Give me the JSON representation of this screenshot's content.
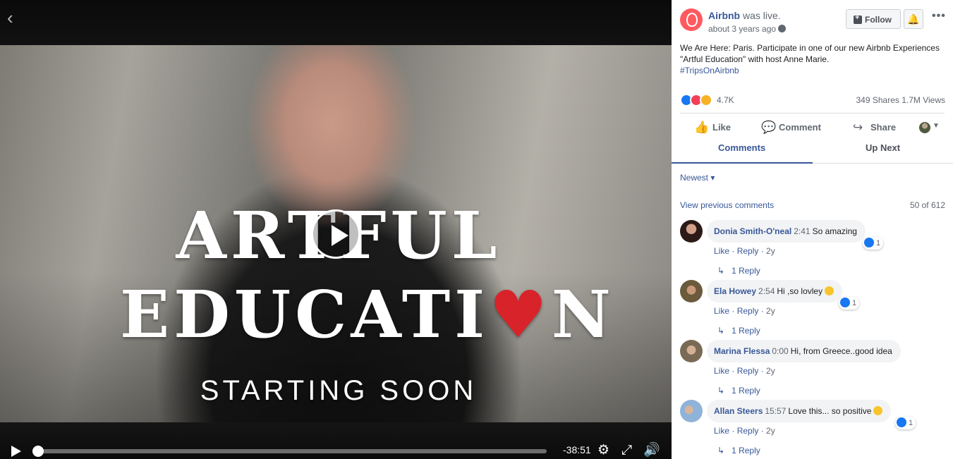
{
  "video": {
    "overlay_line1": "ARTFUL",
    "overlay_line2a": "EDUCATI",
    "overlay_heart": "♥",
    "overlay_line2b": "N",
    "overlay_line3": "STARTING SOON",
    "time_remaining": "-38:51",
    "progress_fraction": 0.01
  },
  "post": {
    "page_name": "Airbnb",
    "status": "was live.",
    "time": "about 3 years ago",
    "follow_label": "Follow",
    "text": "We Are Here: Paris. Participate in one of our new Airbnb Experiences \"Artful Education\" with host Anne Marie.",
    "hashtag": "#TripsOnAirbnb",
    "reaction_count": "4.7K",
    "shares_views": "349 Shares  1.7M Views",
    "brand_color": "#ff5a5f"
  },
  "actions": {
    "like": "Like",
    "comment": "Comment",
    "share": "Share"
  },
  "tabs": {
    "comments": "Comments",
    "up_next": "Up Next"
  },
  "comments_section": {
    "sort_label": "Newest ▾",
    "view_previous": "View previous comments",
    "count": "50 of 612",
    "items": [
      {
        "name": "Donia Smith-O'neal",
        "ts": "2:41",
        "text": "So amazing",
        "like": "Like",
        "reply": "Reply",
        "age": "2y",
        "likes": "1",
        "replies": "1 Reply"
      },
      {
        "name": "Ela Howey",
        "ts": "2:54",
        "text": "Hi ,so lovley",
        "like": "Like",
        "reply": "Reply",
        "age": "2y",
        "likes": "1",
        "replies": "1 Reply"
      },
      {
        "name": "Marina Flessa",
        "ts": "0:00",
        "text": "Hi, from Greece..good idea",
        "like": "Like",
        "reply": "Reply",
        "age": "2y",
        "likes": "",
        "replies": "1 Reply"
      },
      {
        "name": "Allan Steers",
        "ts": "15:57",
        "text": "Love this... so positive",
        "like": "Like",
        "reply": "Reply",
        "age": "2y",
        "likes": "1",
        "replies": "1 Reply"
      }
    ]
  }
}
